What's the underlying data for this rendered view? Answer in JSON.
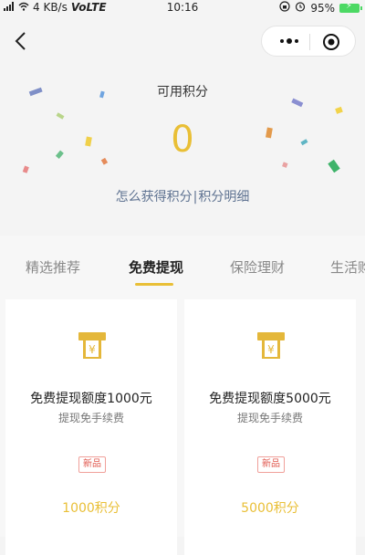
{
  "status_bar": {
    "speed": "4 KB/s",
    "network": "VoLTE",
    "time": "10:16",
    "battery": "95%"
  },
  "points": {
    "label": "可用积分",
    "value": "0",
    "link_earn": "怎么获得积分",
    "separator": "|",
    "link_details": "积分明细"
  },
  "tabs": [
    {
      "label": "精选推荐",
      "active": false
    },
    {
      "label": "免费提现",
      "active": true
    },
    {
      "label": "保险理财",
      "active": false
    },
    {
      "label": "生活购",
      "active": false
    }
  ],
  "cards": [
    {
      "title": "免费提现额度1000元",
      "subtitle": "提现免手续费",
      "badge": "新品",
      "price": "1000积分",
      "icon": "withdraw-cash-icon"
    },
    {
      "title": "免费提现额度5000元",
      "subtitle": "提现免手续费",
      "badge": "新品",
      "price": "5000积分",
      "icon": "withdraw-cash-icon"
    }
  ],
  "colors": {
    "accent": "#e9bf36",
    "link": "#5e7291",
    "badge_red": "#e0564c"
  }
}
